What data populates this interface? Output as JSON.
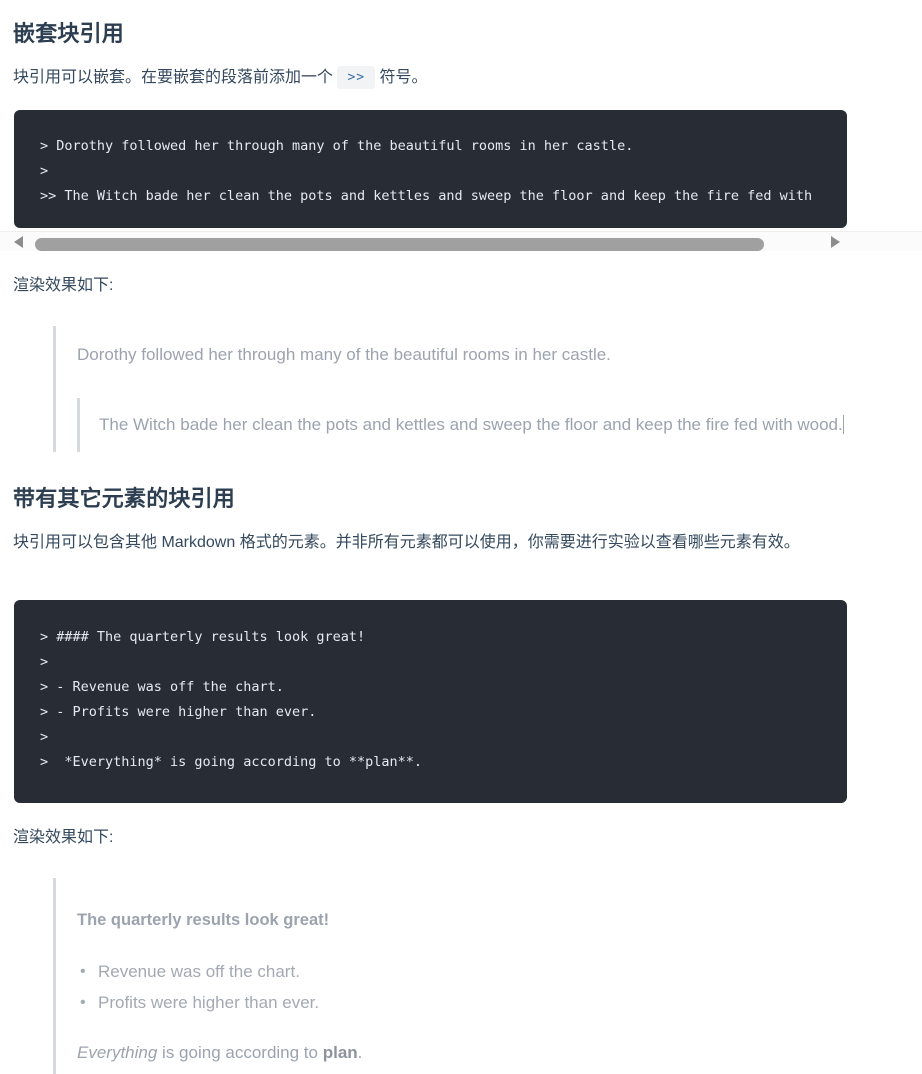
{
  "sections": {
    "nested": {
      "heading": "嵌套块引用",
      "paragraph_before_code": "块引用可以嵌套。在要嵌套的段落前添加一个 ",
      "inline_code": ">>",
      "paragraph_after_code": " 符号。",
      "code": "> Dorothy followed her through many of the beautiful rooms in her castle.\n>\n>> The Witch bade her clean the pots and kettles and sweep the floor and keep the fire fed with",
      "render_label": "渲染效果如下:",
      "quote_outer": "Dorothy followed her through many of the beautiful rooms in her castle.",
      "quote_nested": "The Witch bade her clean the pots and kettles and sweep the floor and keep the fire fed with wood."
    },
    "other_elements": {
      "heading": "带有其它元素的块引用",
      "paragraph": "块引用可以包含其他 Markdown 格式的元素。并非所有元素都可以使用，你需要进行实验以查看哪些元素有效。",
      "code": "> #### The quarterly results look great!\n>\n> - Revenue was off the chart.\n> - Profits were higher than ever.\n>\n>  *Everything* is going according to **plan**.",
      "render_label": "渲染效果如下:",
      "quote_heading": "The quarterly results look great!",
      "quote_list": [
        "Revenue was off the chart.",
        "Profits were higher than ever."
      ],
      "quote_closing_italic": "Everything",
      "quote_closing_mid": " is going according to ",
      "quote_closing_bold": "plan",
      "quote_closing_end": "."
    }
  },
  "scrollbar": {
    "left_arrow": "◀",
    "right_arrow": "▶"
  },
  "colors": {
    "heading": "#2c3e50",
    "body_text": "#34495e",
    "code_background": "#282c35",
    "code_text": "#e6e9ef",
    "quote_text": "#9ca3af",
    "quote_border": "#d6d9dd",
    "inline_code_bg": "#f2f3f5",
    "inline_code_text": "#3a6ea5",
    "scrollbar_thumb": "#a0a0a0"
  }
}
